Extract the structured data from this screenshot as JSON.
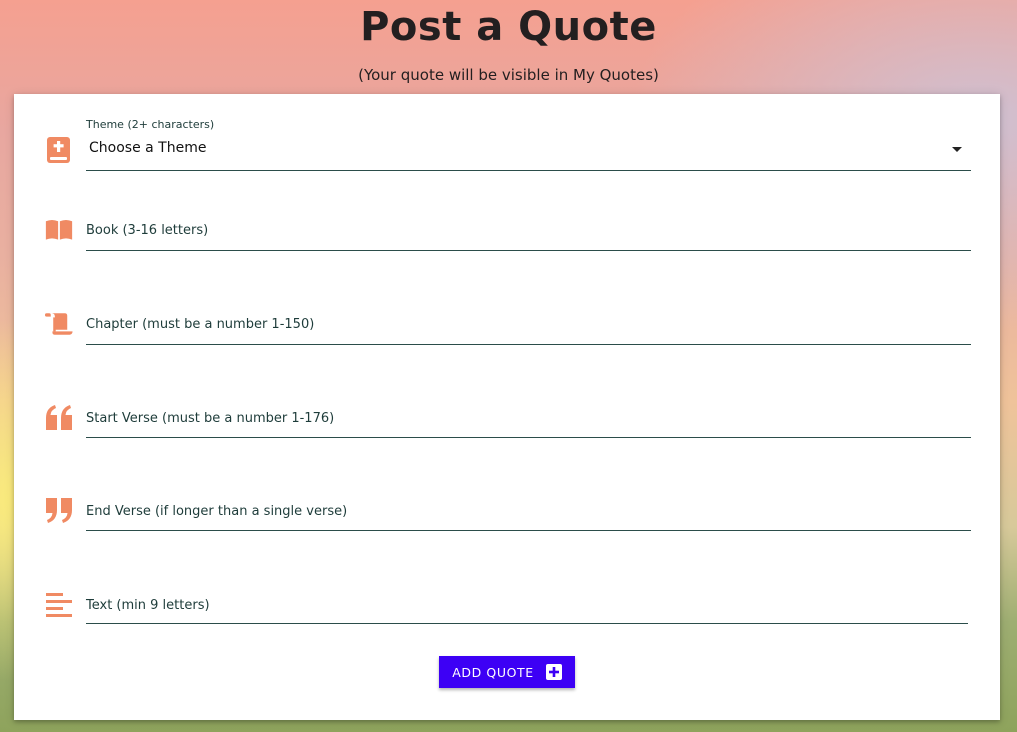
{
  "page": {
    "title": "Post a Quote",
    "subtitle": "(Your quote will be visible in My Quotes)"
  },
  "form": {
    "theme": {
      "label": "Theme (2+ characters)",
      "selected": "Choose a Theme",
      "icon": "bible-icon"
    },
    "book": {
      "label": "Book (3-16 letters)",
      "icon": "book-open-icon"
    },
    "chapter": {
      "label": "Chapter (must be a number 1-150)",
      "icon": "scroll-icon"
    },
    "start_verse": {
      "label": "Start Verse (must be a number 1-176)",
      "icon": "quote-left-icon"
    },
    "end_verse": {
      "label": "End Verse (if longer than a single verse)",
      "icon": "quote-right-icon"
    },
    "text": {
      "label": "Text (min 9 letters)",
      "icon": "align-left-icon"
    },
    "submit_label": "ADD QUOTE"
  },
  "colors": {
    "icon": "#f08a63",
    "underline": "#2b4d4a",
    "button": "#3d00f5"
  }
}
